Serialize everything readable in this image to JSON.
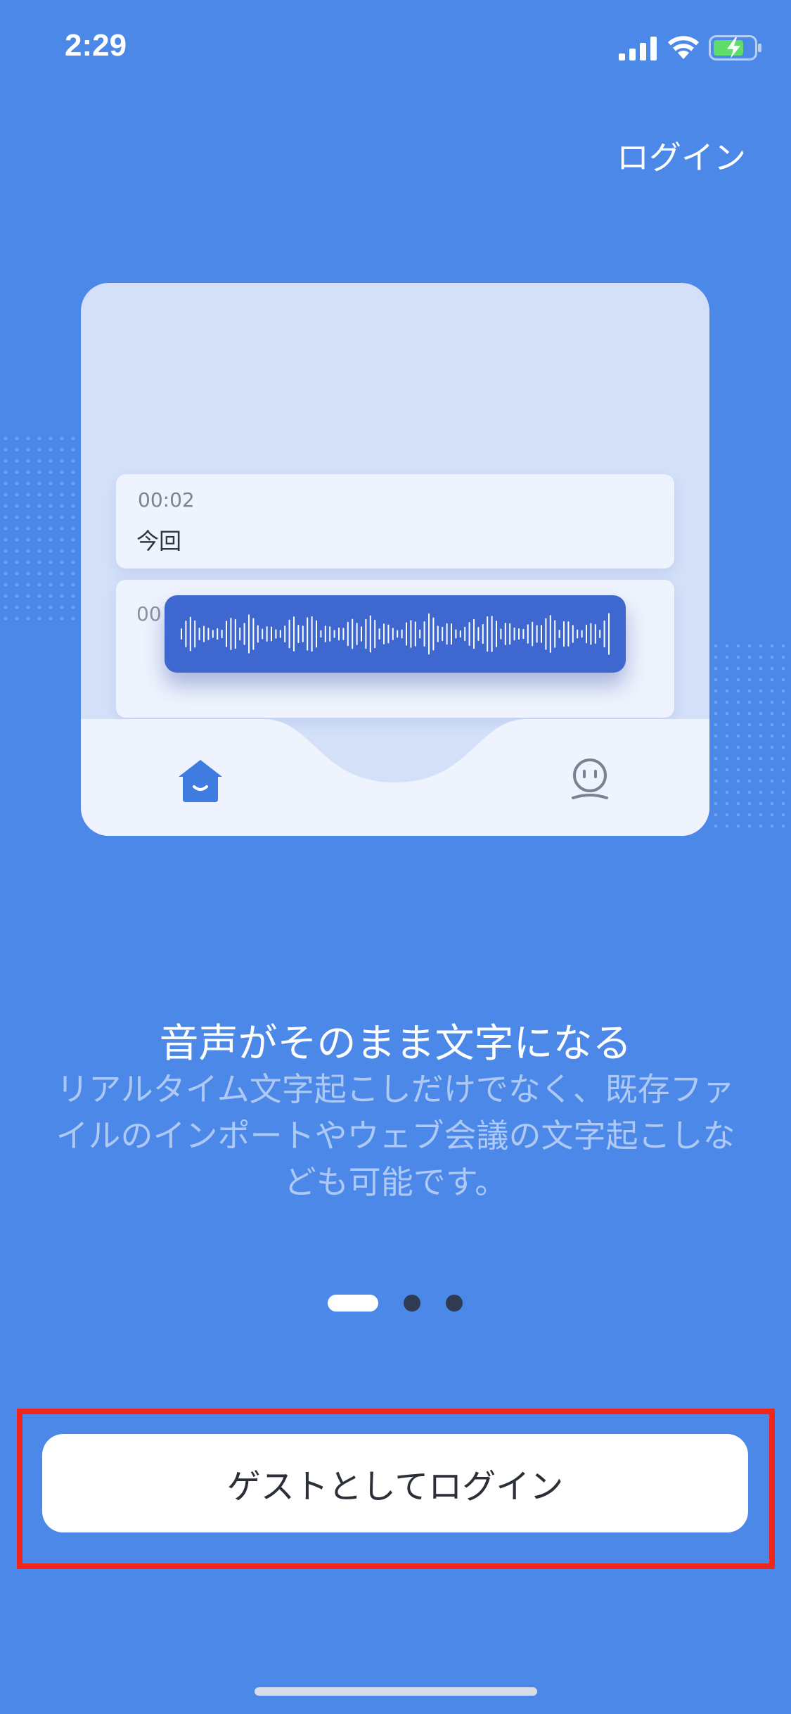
{
  "status_bar": {
    "time": "2:29",
    "icons": [
      "signal-icon",
      "wifi-icon",
      "battery-charging-icon"
    ]
  },
  "header": {
    "login_label": "ログイン"
  },
  "illustration": {
    "card_1": {
      "time": "00:02",
      "text": "今回"
    },
    "card_2": {
      "time": "00"
    },
    "tabbar_icons": [
      "home-icon",
      "profile-icon"
    ]
  },
  "onboarding": {
    "title": "音声がそのまま文字になる",
    "description": "リアルタイム文字起こしだけでなく、既存ファイルのインポートやウェブ会議の文字起こしなども可能です。",
    "page_count": 3,
    "current_page": 1
  },
  "actions": {
    "guest_login_label": "ゲストとしてログイン"
  },
  "colors": {
    "background": "#4c88e8",
    "accent": "#3e68d0",
    "highlight": "#f0261a"
  }
}
